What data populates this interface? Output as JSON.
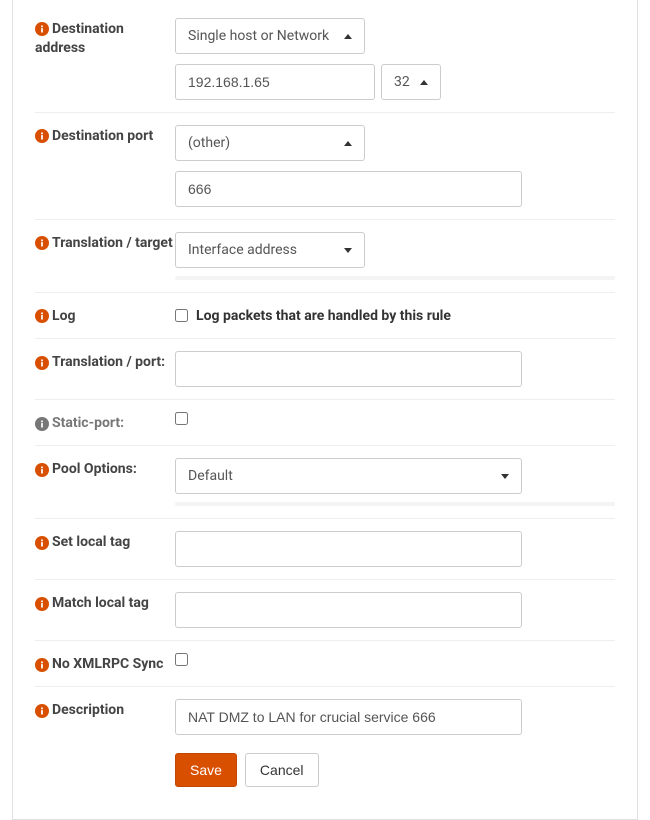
{
  "dest_addr": {
    "label": "Destination address",
    "select_value": "Single host or Network",
    "ip_value": "192.168.1.65",
    "mask_value": "32"
  },
  "dest_port": {
    "label": "Destination port",
    "select_value": "(other)",
    "port_value": "666"
  },
  "translation_target": {
    "label": "Translation / target",
    "select_value": "Interface address"
  },
  "log": {
    "label": "Log",
    "checkbox_label": "Log packets that are handled by this rule"
  },
  "translation_port": {
    "label": "Translation / port:",
    "value": ""
  },
  "static_port": {
    "label": "Static-port:"
  },
  "pool_options": {
    "label": "Pool Options:",
    "select_value": "Default"
  },
  "set_local_tag": {
    "label": "Set local tag",
    "value": ""
  },
  "match_local_tag": {
    "label": "Match local tag",
    "value": ""
  },
  "no_xmlrpc": {
    "label": "No XMLRPC Sync"
  },
  "description": {
    "label": "Description",
    "value": "NAT DMZ to LAN for crucial service 666"
  },
  "buttons": {
    "save": "Save",
    "cancel": "Cancel"
  }
}
